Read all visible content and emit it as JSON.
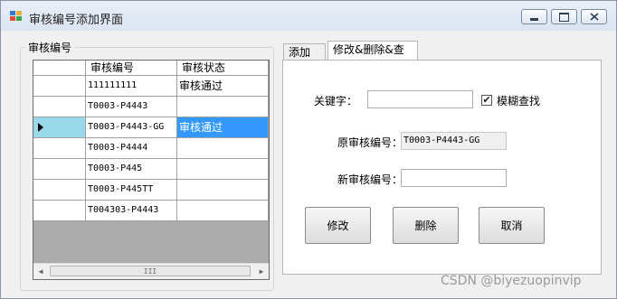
{
  "window": {
    "title": "审核编号添加界面"
  },
  "groupbox": {
    "label": "审核编号"
  },
  "grid": {
    "columns": [
      "审核编号",
      "审核状态"
    ],
    "rows": [
      {
        "id": "111111111",
        "status": "审核通过"
      },
      {
        "id": "T0003-P4443",
        "status": ""
      },
      {
        "id": "T0003-P4443-GG",
        "status": "审核通过"
      },
      {
        "id": "T0003-P4444",
        "status": ""
      },
      {
        "id": "T0003-P445",
        "status": ""
      },
      {
        "id": "T0003-P445TT",
        "status": ""
      },
      {
        "id": "T004303-P4443",
        "status": ""
      }
    ],
    "scroll_thumb": "III"
  },
  "tabs": [
    {
      "label": "添加"
    },
    {
      "label": "修改&删除&查找"
    }
  ],
  "form": {
    "keyword_label": "关键字：",
    "keyword_value": "",
    "fuzzy_label": "模糊查找",
    "fuzzy_checked": true,
    "fuzzy_check": "✔",
    "original_label": "原审核编号：",
    "original_value": "T0003-P4443-GG",
    "new_label": "新审核编号：",
    "new_value": ""
  },
  "buttons": {
    "modify": "修改",
    "delete": "删除",
    "cancel": "取消"
  },
  "watermark": "CSDN @biyezuopinvip",
  "colors": {
    "selection": "#3399ff",
    "row_header_selected": "#99d9ea"
  }
}
